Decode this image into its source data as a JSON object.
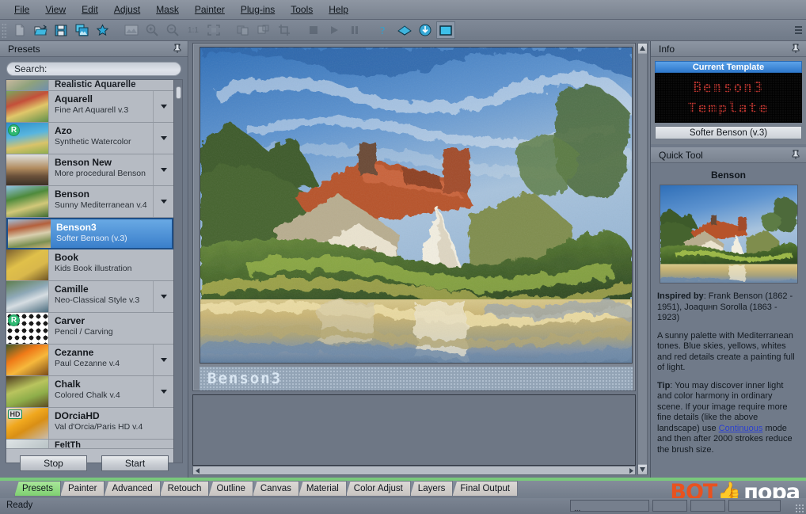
{
  "menu": {
    "items": [
      {
        "label": "File",
        "accel": "F"
      },
      {
        "label": "View",
        "accel": "V"
      },
      {
        "label": "Edit",
        "accel": "E"
      },
      {
        "label": "Adjust",
        "accel": "A"
      },
      {
        "label": "Mask",
        "accel": "M"
      },
      {
        "label": "Painter",
        "accel": "P"
      },
      {
        "label": "Plug-ins",
        "accel": "P"
      },
      {
        "label": "Tools",
        "accel": "T"
      },
      {
        "label": "Help",
        "accel": "H"
      }
    ]
  },
  "toolbar": {
    "buttons": [
      {
        "name": "new-file-icon",
        "enabled": false
      },
      {
        "name": "open-folder-icon",
        "enabled": true
      },
      {
        "name": "save-icon",
        "enabled": true
      },
      {
        "name": "copy-image-icon",
        "enabled": true
      },
      {
        "name": "favorite-star-icon",
        "enabled": true
      },
      {
        "name": "image-icon",
        "enabled": false
      },
      {
        "name": "zoom-in-icon",
        "enabled": false
      },
      {
        "name": "zoom-out-icon",
        "enabled": false
      },
      {
        "name": "zoom-actual-size-icon",
        "label": "1:1",
        "enabled": false
      },
      {
        "name": "fit-to-window-icon",
        "enabled": false
      },
      {
        "name": "tile-horizontal-icon",
        "enabled": false
      },
      {
        "name": "tile-vertical-icon",
        "enabled": false
      },
      {
        "name": "crop-icon",
        "enabled": false
      },
      {
        "name": "stop-icon",
        "enabled": false
      },
      {
        "name": "play-icon",
        "enabled": false
      },
      {
        "name": "pause-icon",
        "enabled": false
      },
      {
        "name": "help-icon",
        "enabled": true
      },
      {
        "name": "book-icon",
        "enabled": true
      },
      {
        "name": "download-icon",
        "enabled": true
      },
      {
        "name": "screen-icon",
        "enabled": true
      }
    ]
  },
  "presets_panel": {
    "title": "Presets",
    "search": {
      "label": "Search:",
      "value": "",
      "placeholder": "Search:"
    },
    "items": [
      {
        "name": "",
        "desc": "Realistic Aquarelle",
        "partial": true,
        "dropdown": false,
        "badge": ""
      },
      {
        "name": "Aquarell",
        "desc": "Fine Art Aquarell v.3",
        "dropdown": true,
        "badge": ""
      },
      {
        "name": "Azo",
        "desc": "Synthetic Watercolor",
        "dropdown": true,
        "badge": "R"
      },
      {
        "name": "Benson New",
        "desc": "More procedural Benson",
        "dropdown": true,
        "badge": ""
      },
      {
        "name": "Benson",
        "desc": "Sunny Mediterranean v.4",
        "dropdown": true,
        "badge": ""
      },
      {
        "name": "Benson3",
        "desc": "Softer Benson (v.3)",
        "dropdown": false,
        "badge": "",
        "selected": true
      },
      {
        "name": "Book",
        "desc": "Kids Book illustration",
        "dropdown": false,
        "badge": ""
      },
      {
        "name": "Camille",
        "desc": "Neo-Classical Style v.3",
        "dropdown": true,
        "badge": ""
      },
      {
        "name": "Carver",
        "desc": "Pencil / Carving",
        "dropdown": false,
        "badge": "R"
      },
      {
        "name": "Cezanne",
        "desc": "Paul Cezanne v.4",
        "dropdown": true,
        "badge": ""
      },
      {
        "name": "Chalk",
        "desc": "Colored Chalk v.4",
        "dropdown": true,
        "badge": ""
      },
      {
        "name": "DOrciaHD",
        "desc": "Val d'Orcia/Paris HD v.4",
        "dropdown": false,
        "badge": "HD"
      },
      {
        "name": "FeltTh",
        "desc": "",
        "partial": true,
        "dropdown": false,
        "badge": ""
      }
    ],
    "stop_label": "Stop",
    "start_label": "Start"
  },
  "canvas": {
    "matrix_label": "Benson3"
  },
  "info_panel": {
    "title": "Info",
    "current_template_label": "Current Template",
    "led_line1": "Benson3",
    "led_line2": "Template",
    "template_name": "Softer Benson (v.3)",
    "led_color": "#b2342e"
  },
  "quick_tool": {
    "title": "Quick Tool",
    "preset_name": "Benson",
    "inspired_label": "Inspired by",
    "inspired_text": ": Frank Benson (1862 - 1951), Joaquнn Sorolla (1863 - 1923)",
    "description": "A sunny palette with Mediterranean tones. Blue skies, yellows, whites and red details create a painting full of light.",
    "tip_label": "Tip",
    "tip_part1": ": You may discover inner light and color harmony in ordinary scene. If your image require more fine details (like the above landscape) use ",
    "tip_link": "Continuous",
    "tip_part2": " mode and then after 2000 strokes reduce the brush size."
  },
  "tabs": {
    "items": [
      {
        "label": "Presets",
        "active": true
      },
      {
        "label": "Painter",
        "active": false
      },
      {
        "label": "Advanced",
        "active": false
      },
      {
        "label": "Retouch",
        "active": false
      },
      {
        "label": "Outline",
        "active": false
      },
      {
        "label": "Canvas",
        "active": false
      },
      {
        "label": "Material",
        "active": false
      },
      {
        "label": "Color Adjust",
        "active": false
      },
      {
        "label": "Layers",
        "active": false
      },
      {
        "label": "Final Output",
        "active": false
      }
    ]
  },
  "statusbar": {
    "text": "Ready",
    "panel1": "...",
    "panel2": "",
    "panel3": "",
    "panel4": ""
  },
  "watermark": {
    "part1": "ВОТ",
    "part2": "пора",
    "icon": "thumbs-up-icon"
  },
  "colors": {
    "accent_blue": "#3a7fcb",
    "tab_active_green": "#7fd071",
    "led_red": "#b2342e",
    "link_blue": "#2a3fd0",
    "watermark_orange": "#e8521f"
  }
}
